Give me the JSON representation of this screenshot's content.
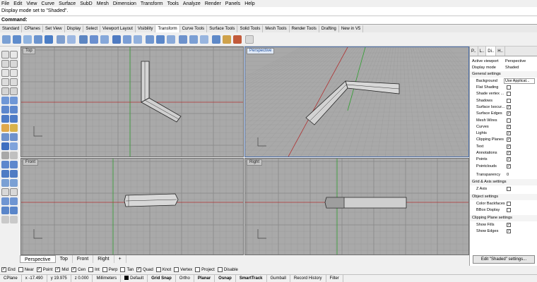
{
  "menu": [
    "File",
    "Edit",
    "View",
    "Curve",
    "Surface",
    "SubD",
    "Mesh",
    "Dimension",
    "Transform",
    "Tools",
    "Analyze",
    "Render",
    "Panels",
    "Help"
  ],
  "command_history": "Display mode set to \"Shaded\".",
  "command_label": "Command:",
  "toolbar_tabs": [
    "Standard",
    "CPlanes",
    "Set View",
    "Display",
    "Select",
    "Viewport Layout",
    "Visibility",
    "Transform",
    "Curve Tools",
    "Surface Tools",
    "Solid Tools",
    "Mesh Tools",
    "Render Tools",
    "Drafting",
    "New in V5"
  ],
  "active_toolbar_tab": "Transform",
  "viewports": {
    "top": "Top",
    "perspective": "Perspective",
    "front": "Front",
    "right": "Right"
  },
  "viewport_tabs": [
    "Perspective",
    "Top",
    "Front",
    "Right",
    "+"
  ],
  "osnaps": [
    {
      "label": "End",
      "checked": true
    },
    {
      "label": "Near",
      "checked": false
    },
    {
      "label": "Point",
      "checked": true
    },
    {
      "label": "Mid",
      "checked": true
    },
    {
      "label": "Cen",
      "checked": true
    },
    {
      "label": "Int",
      "checked": false
    },
    {
      "label": "Perp",
      "checked": false
    },
    {
      "label": "Tan",
      "checked": false
    },
    {
      "label": "Quad",
      "checked": true
    },
    {
      "label": "Knot",
      "checked": false
    },
    {
      "label": "Vertex",
      "checked": false
    },
    {
      "label": "Project",
      "checked": false
    },
    {
      "label": "Disable",
      "checked": false
    }
  ],
  "status": {
    "cplane": "CPlane",
    "x": "x -17.490",
    "y": "y 19.975",
    "z": "z 0.000",
    "units": "Millimeters",
    "layer": "Default",
    "grid_snap": "Grid Snap",
    "ortho": "Ortho",
    "planar": "Planar",
    "osnap": "Osnap",
    "smarttrack": "SmartTrack",
    "gumball": "Gumball",
    "record_history": "Record History",
    "filter": "Filter"
  },
  "panel": {
    "tabs": [
      "P..",
      "L..",
      "Di..",
      "H.."
    ],
    "active_viewport_label": "Active viewport",
    "active_viewport_value": "Perspective",
    "display_mode_label": "Display mode",
    "display_mode_value": "Shaded",
    "general_settings": "General settings",
    "background_label": "Background",
    "background_value": "Use Applicat...",
    "rows": [
      {
        "label": "Flat Shading",
        "checked": false
      },
      {
        "label": "Shade vertex ...",
        "checked": false
      },
      {
        "label": "Shadows",
        "checked": false
      },
      {
        "label": "Surface Isocur...",
        "checked": true
      },
      {
        "label": "Surface Edges",
        "checked": true
      },
      {
        "label": "Mesh Wires",
        "checked": false
      },
      {
        "label": "Curves",
        "checked": true
      },
      {
        "label": "Lights",
        "checked": true
      },
      {
        "label": "Clipping Planes",
        "checked": true
      },
      {
        "label": "Text",
        "checked": true
      },
      {
        "label": "Annotations",
        "checked": true
      },
      {
        "label": "Points",
        "checked": true
      },
      {
        "label": "Pointclouds",
        "checked": true
      }
    ],
    "transparency_label": "Transparency",
    "transparency_value": "0",
    "grid_axis_settings": "Grid & Axis settings",
    "z_axis_label": "Z Axis",
    "object_settings": "Object settings",
    "color_backfaces_label": "Color Backfaces",
    "bbox_display_label": "BBox Display",
    "clipping_plane_settings": "Clipping Plane settings",
    "show_fills_label": "Show Fills",
    "show_edges_label": "Show Edges",
    "edit_button": "Edit \"Shaded\" settings..."
  }
}
